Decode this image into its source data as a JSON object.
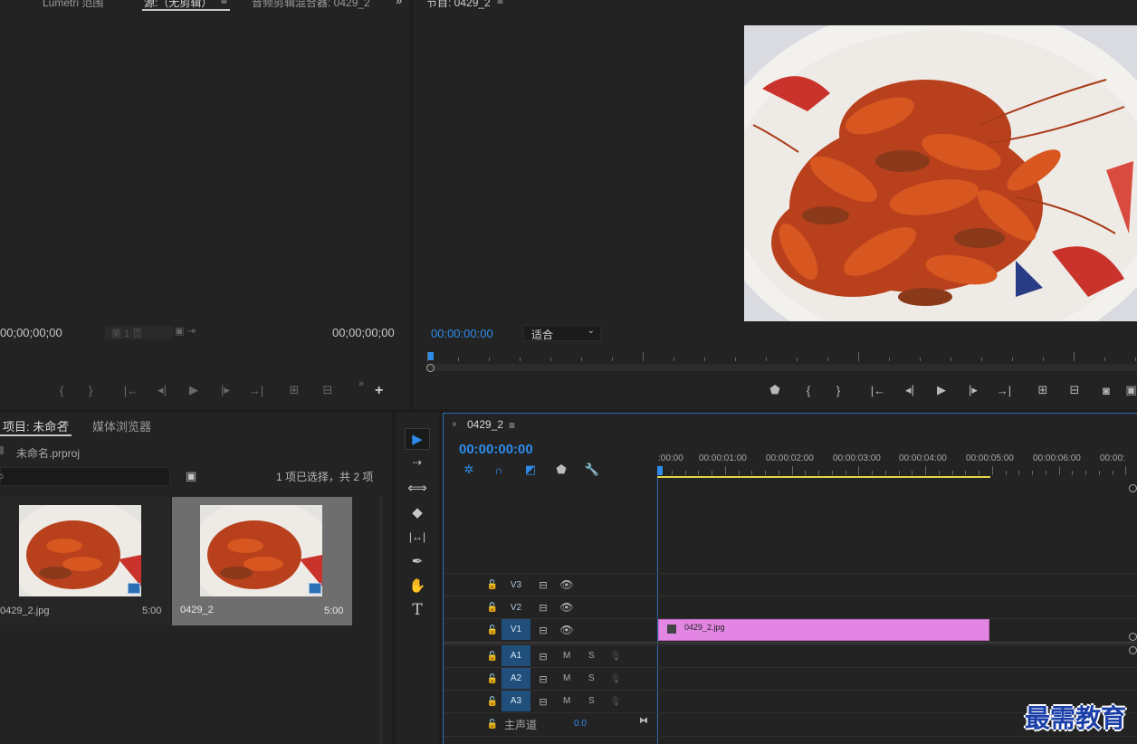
{
  "tabs_top_left": [
    "Lumetri 范围",
    "源:（无剪辑）",
    "音频剪辑混合器: 0429_2"
  ],
  "source_monitor": {
    "timecode_left": "00;00;00;00",
    "page_label": "第 1 页",
    "timecode_right": "00;00;00;00"
  },
  "program_monitor": {
    "tab": "节目: 0429_2",
    "timecode": "00:00:00:00",
    "fit_label": "适合"
  },
  "project_panel": {
    "tabs": [
      "项目: 未命名",
      "媒体浏览器"
    ],
    "project_file": "未命名.prproj",
    "selection_info": "1 项已选择，共 2 项",
    "items": [
      {
        "name": "0429_2.jpg",
        "duration": "5:00"
      },
      {
        "name": "0429_2",
        "duration": "5:00"
      }
    ]
  },
  "timeline": {
    "tab": "0429_2",
    "timecode": "00:00:00:00",
    "ruler": [
      ":00:00",
      "00:00:01:00",
      "00:00:02:00",
      "00:00:03:00",
      "00:00:04:00",
      "00:00:05:00",
      "00:00:06:00",
      "00:00:"
    ],
    "video_tracks": [
      "V3",
      "V2",
      "V1"
    ],
    "audio_tracks": [
      "A1",
      "A2",
      "A3"
    ],
    "clip_name": "0429_2.jpg",
    "master_label": "主声道",
    "master_value": "0.0",
    "mute": "M",
    "solo": "S"
  },
  "watermark": "最需教育",
  "colors": {
    "accent_blue": "#2d8ceb",
    "clip_pink": "#e386e3",
    "work_area_yellow": "#e8d64a"
  }
}
